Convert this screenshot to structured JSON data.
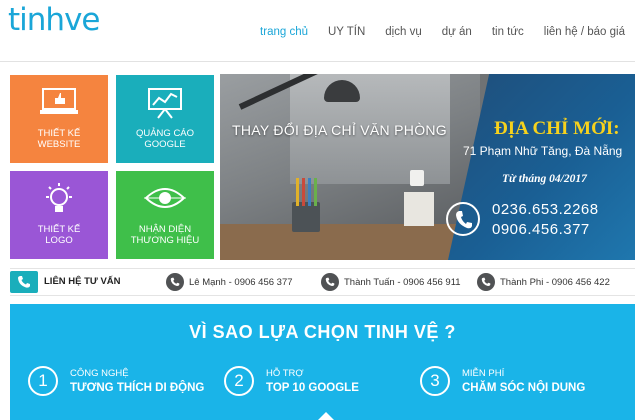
{
  "header": {
    "logo": "tinhve",
    "nav": [
      "trang chủ",
      "UY TÍN",
      "dịch vụ",
      "dự án",
      "tin tức",
      "liên hệ / báo giá"
    ]
  },
  "tiles": [
    {
      "label1": "THIẾT KẾ",
      "label2": "WEBSITE",
      "icon": "laptop-like-icon",
      "color": "#f5843f"
    },
    {
      "label1": "QUẢNG CÁO",
      "label2": "GOOGLE",
      "icon": "chart-board-icon",
      "color": "#1aaebb"
    },
    {
      "label1": "THIẾT KẾ",
      "label2": "LOGO",
      "icon": "lightbulb-icon",
      "color": "#9a56d6"
    },
    {
      "label1": "NHẬN DIỆN",
      "label2": "THƯƠNG HIỆU",
      "icon": "eye-icon",
      "color": "#3fbf4a"
    }
  ],
  "banner": {
    "headline": "THAY ĐỔI ĐỊA CHỈ VĂN PHÒNG",
    "new_address_title": "ĐỊA CHỈ MỚI:",
    "address": "71 Phạm Nhữ Tăng, Đà Nẵng",
    "since": "Từ tháng 04/2017",
    "phone1": "0236.653.2268",
    "phone2": "0906.456.377",
    "accent": "#f7d21c"
  },
  "contact_bar": {
    "title": "LIÊN HỆ TƯ VẤN",
    "people": [
      "Lê Mạnh - 0906 456 377",
      "Thành Tuấn - 0906 456 911",
      "Thành Phi - 0906 456 422"
    ]
  },
  "why": {
    "title": "VÌ SAO LỰA CHỌN TINH VỆ ?",
    "items": [
      {
        "num": "1",
        "line1": "CÔNG NGHỆ",
        "line2": "TƯƠNG THÍCH DI ĐỘNG"
      },
      {
        "num": "2",
        "line1": "HỖ TRỢ",
        "line2": "TOP 10 GOOGLE"
      },
      {
        "num": "3",
        "line1": "MIỄN PHÍ",
        "line2": "CHĂM SÓC NỘI DUNG"
      }
    ],
    "background": "#1ab4e8"
  }
}
